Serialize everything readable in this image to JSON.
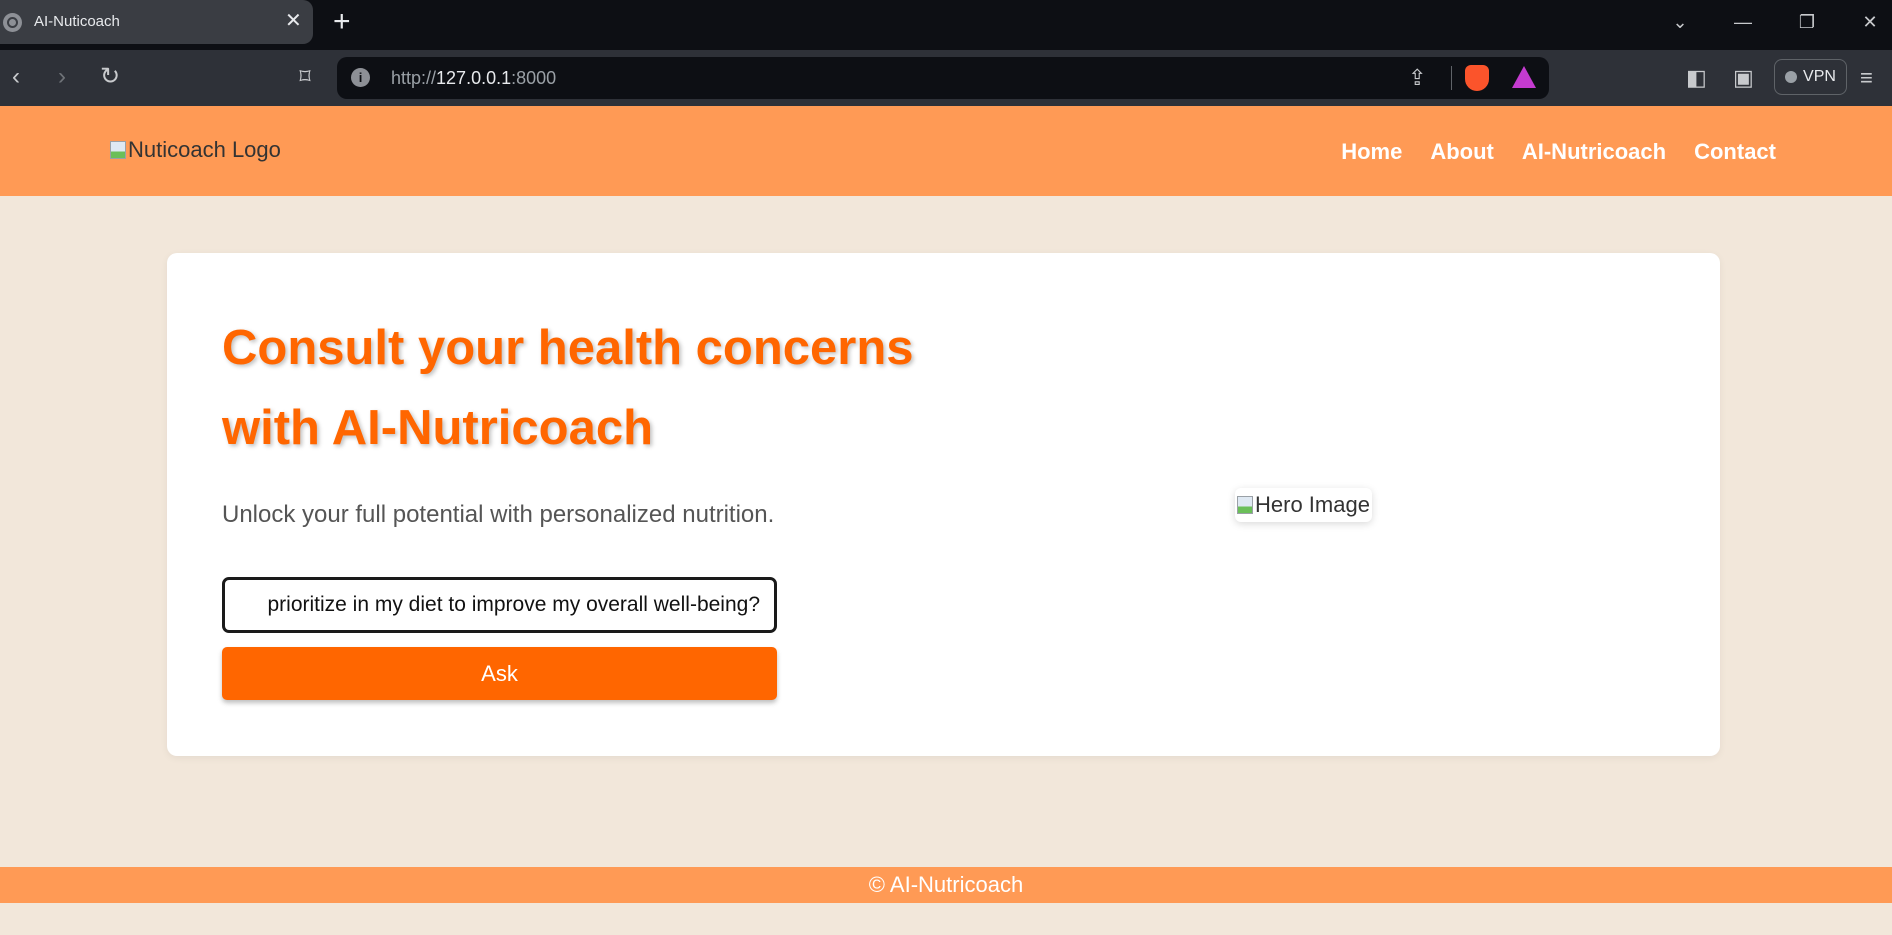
{
  "browser": {
    "tab_title": "AI-Nuticoach",
    "tab_close": "✕",
    "new_tab": "+",
    "url_prefix": "http://",
    "url_host": "127.0.0.1",
    "url_port": ":8000",
    "vpn_label": "VPN"
  },
  "header": {
    "logo_alt": "Nuticoach Logo",
    "nav": [
      "Home",
      "About",
      "AI-Nutricoach",
      "Contact"
    ]
  },
  "hero": {
    "headline_line1": "Consult your health concerns",
    "headline_line2": "with AI-Nutricoach",
    "subtitle": "Unlock your full potential with personalized nutrition.",
    "question_value": "prioritize in my diet to improve my overall well-being?",
    "ask_label": "Ask",
    "image_alt": "Hero Image"
  },
  "footer": {
    "text": "© AI-Nutricoach"
  },
  "colors": {
    "header_bg": "#ff9a55",
    "accent": "#ff6600",
    "page_bg": "#f2e7da"
  }
}
